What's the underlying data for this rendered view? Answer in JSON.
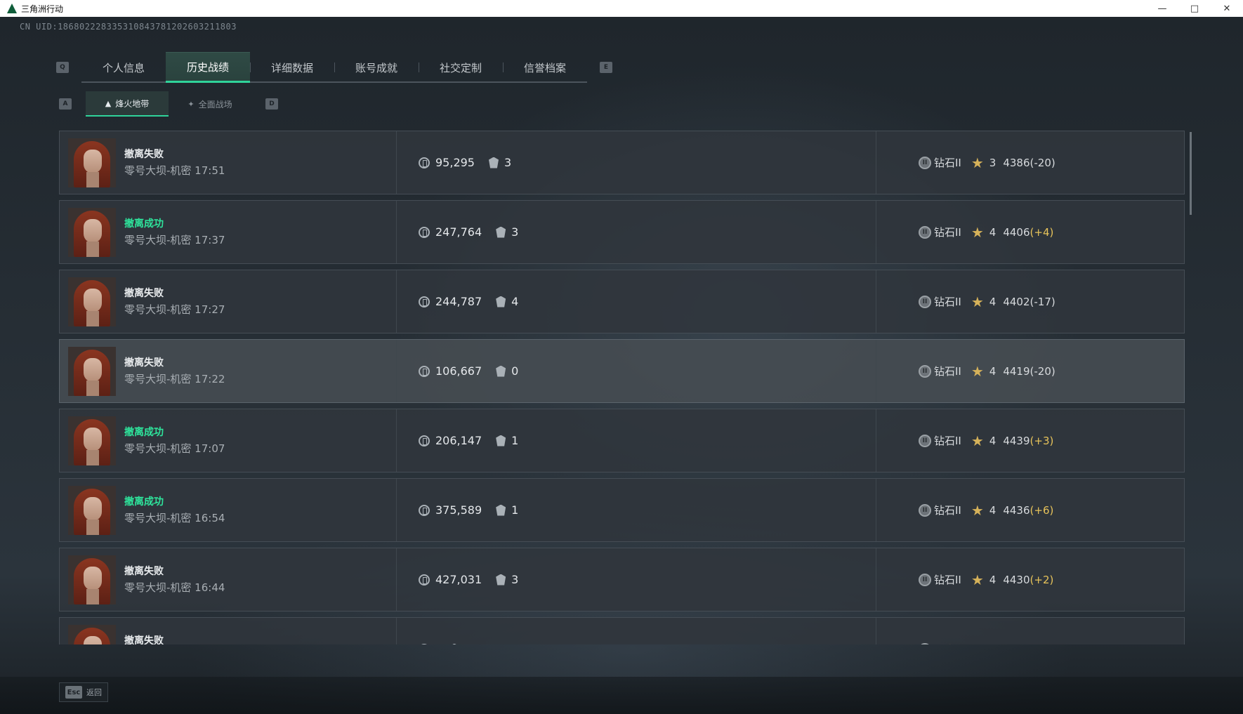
{
  "window": {
    "title": "三角洲行动"
  },
  "header": {
    "uid": "CN UID:18680222833531084378120260321180З"
  },
  "tabs": {
    "prev_key": "Q",
    "next_key": "E",
    "items": [
      {
        "label": "个人信息"
      },
      {
        "label": "历史战绩"
      },
      {
        "label": "详细数据"
      },
      {
        "label": "账号成就"
      },
      {
        "label": "社交定制"
      },
      {
        "label": "信誉档案"
      }
    ]
  },
  "subtabs": {
    "prev_key": "A",
    "next_key": "D",
    "items": [
      {
        "label": "烽火地带",
        "icon": "extraction-icon"
      },
      {
        "label": "全面战场",
        "icon": "battlefield-icon"
      }
    ]
  },
  "records": [
    {
      "result": "撤离失败",
      "success": false,
      "map": "零号大坝-机密 17:51",
      "value": "95,295",
      "kills": "3",
      "rank": "钻石II",
      "stars": "3",
      "score": "4386",
      "delta": "(-20)",
      "delta_positive": false
    },
    {
      "result": "撤离成功",
      "success": true,
      "map": "零号大坝-机密 17:37",
      "value": "247,764",
      "kills": "3",
      "rank": "钻石II",
      "stars": "4",
      "score": "4406",
      "delta": "(+4)",
      "delta_positive": true
    },
    {
      "result": "撤离失败",
      "success": false,
      "map": "零号大坝-机密 17:27",
      "value": "244,787",
      "kills": "4",
      "rank": "钻石II",
      "stars": "4",
      "score": "4402",
      "delta": "(-17)",
      "delta_positive": false
    },
    {
      "result": "撤离失败",
      "success": false,
      "map": "零号大坝-机密 17:22",
      "value": "106,667",
      "kills": "0",
      "rank": "钻石II",
      "stars": "4",
      "score": "4419",
      "delta": "(-20)",
      "delta_positive": false
    },
    {
      "result": "撤离成功",
      "success": true,
      "map": "零号大坝-机密 17:07",
      "value": "206,147",
      "kills": "1",
      "rank": "钻石II",
      "stars": "4",
      "score": "4439",
      "delta": "(+3)",
      "delta_positive": true
    },
    {
      "result": "撤离成功",
      "success": true,
      "map": "零号大坝-机密 16:54",
      "value": "375,589",
      "kills": "1",
      "rank": "钻石II",
      "stars": "4",
      "score": "4436",
      "delta": "(+6)",
      "delta_positive": true
    },
    {
      "result": "撤离失败",
      "success": false,
      "map": "零号大坝-机密 16:44",
      "value": "427,031",
      "kills": "3",
      "rank": "钻石II",
      "stars": "4",
      "score": "4430",
      "delta": "(+2)",
      "delta_positive": true
    },
    {
      "result": "撤离失败",
      "success": false,
      "map": "",
      "value": "",
      "kills": "",
      "rank": "",
      "stars": "",
      "score": "",
      "delta": "",
      "delta_positive": false
    }
  ],
  "footer": {
    "esc_key": "Esc",
    "back_label": "返回"
  },
  "colors": {
    "accent": "#2fd39a",
    "success": "#2ee69d",
    "positive_delta": "#e7c35a"
  }
}
